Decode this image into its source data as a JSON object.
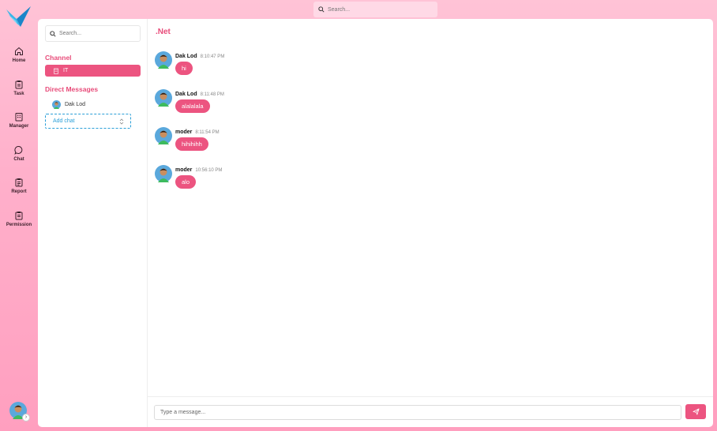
{
  "top_search": {
    "placeholder": "Search..."
  },
  "nav": [
    {
      "label": "Home",
      "icon": "home-icon"
    },
    {
      "label": "Task",
      "icon": "clipboard-icon"
    },
    {
      "label": "Manager",
      "icon": "building-icon"
    },
    {
      "label": "Chat",
      "icon": "chat-bubble-icon"
    },
    {
      "label": "Report",
      "icon": "report-icon"
    },
    {
      "label": "Permission",
      "icon": "permission-icon"
    }
  ],
  "sidebar": {
    "search_placeholder": "Search...",
    "channel_title": "Channel",
    "channels": [
      {
        "label": "IT",
        "icon": "building-icon"
      }
    ],
    "dm_title": "Direct Messages",
    "dms": [
      {
        "label": "Dak Lod"
      }
    ],
    "add_chat_label": "Add chat"
  },
  "chat": {
    "title": ".Net",
    "messages": [
      {
        "name": "Dak Lod",
        "time": "8:10:47 PM",
        "text": "hi"
      },
      {
        "name": "Dak Lod",
        "time": "8:11:48 PM",
        "text": "alalalala"
      },
      {
        "name": "moder",
        "time": "8:11:54 PM",
        "text": "hihihihh"
      },
      {
        "name": "moder",
        "time": "10:56:10 PM",
        "text": "alo"
      }
    ],
    "input_placeholder": "Type a message..."
  },
  "colors": {
    "accent": "#ec5480",
    "title": "#e84c7a",
    "add_chat": "#2a9fd8"
  }
}
